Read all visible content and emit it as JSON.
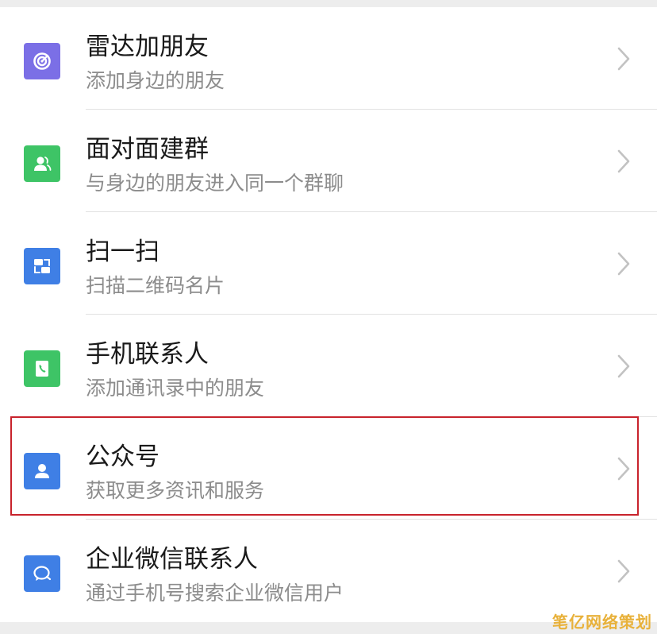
{
  "colors": {
    "radar": "#7b6fe6",
    "face_to_face": "#3ec466",
    "scan": "#3f7fe5",
    "contacts": "#3ec466",
    "official_accounts": "#3f7fe5",
    "enterprise": "#3f7fe5",
    "highlight_border": "#c8232c"
  },
  "menu": {
    "items": [
      {
        "icon": "radar-icon",
        "title": "雷达加朋友",
        "subtitle": "添加身边的朋友"
      },
      {
        "icon": "face-to-face-group-icon",
        "title": "面对面建群",
        "subtitle": "与身边的朋友进入同一个群聊"
      },
      {
        "icon": "scan-icon",
        "title": "扫一扫",
        "subtitle": "扫描二维码名片"
      },
      {
        "icon": "phone-contacts-icon",
        "title": "手机联系人",
        "subtitle": "添加通讯录中的朋友"
      },
      {
        "icon": "official-accounts-icon",
        "title": "公众号",
        "subtitle": "获取更多资讯和服务"
      },
      {
        "icon": "enterprise-wechat-icon",
        "title": "企业微信联系人",
        "subtitle": "通过手机号搜索企业微信用户"
      }
    ]
  },
  "watermark": {
    "text": "笔亿网络策划"
  }
}
